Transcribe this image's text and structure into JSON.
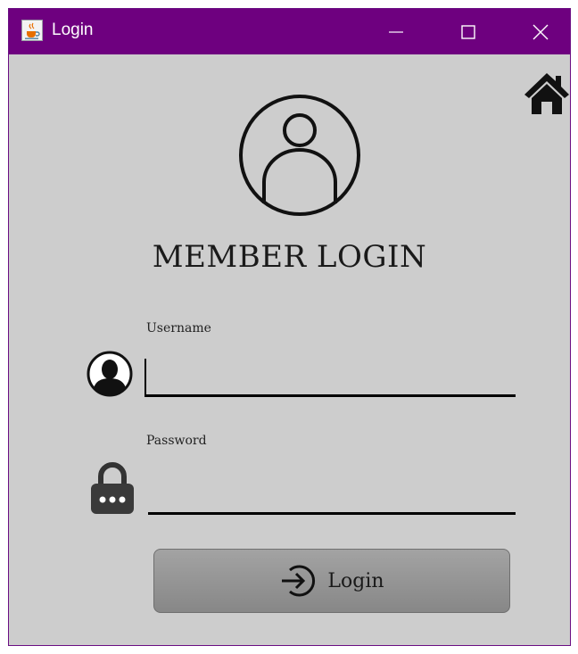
{
  "window": {
    "title": "Login",
    "icons": [
      "java-cup-icon",
      "minimize-icon",
      "maximize-icon",
      "close-icon"
    ]
  },
  "header": {
    "heading": "MEMBER LOGIN",
    "icons": [
      "home-icon",
      "user-circle-icon"
    ]
  },
  "form": {
    "username_label": "Username",
    "username_value": "",
    "password_label": "Password",
    "password_value": "",
    "icons": [
      "user-silhouette-icon",
      "lock-icon"
    ]
  },
  "login_button": {
    "label": "Login",
    "icon": "sign-in-arrow-icon"
  },
  "colors": {
    "titlebar": "#6e007f",
    "background": "#cdcdcd",
    "button": "#959595"
  }
}
